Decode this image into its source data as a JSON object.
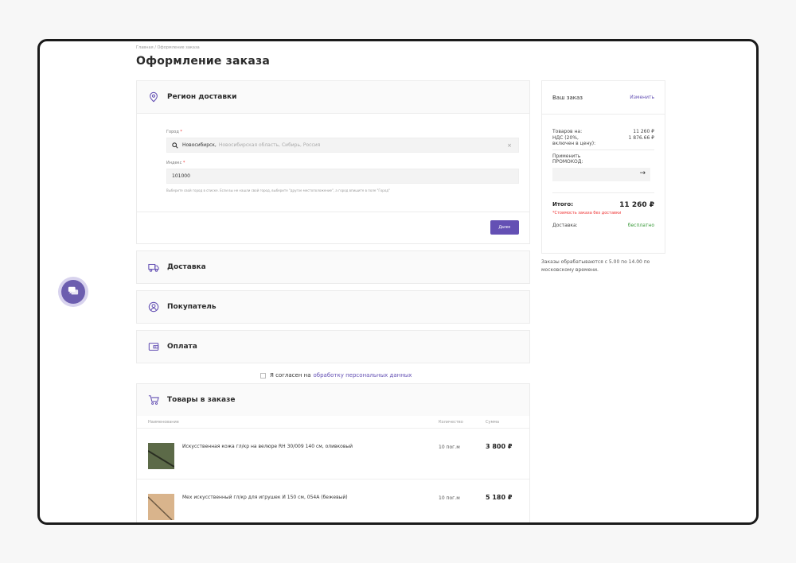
{
  "breadcrumb": {
    "home": "Главная",
    "sep": "/",
    "current": "Оформление заказа"
  },
  "page_title": "Оформление заказа",
  "sections": {
    "region": {
      "title": "Регион доставки"
    },
    "delivery": {
      "title": "Доставка"
    },
    "buyer": {
      "title": "Покупатель"
    },
    "payment": {
      "title": "Оплата"
    },
    "goods": {
      "title": "Товары в заказе"
    }
  },
  "region_form": {
    "city_label": "Город",
    "city_value": "Новосибирск",
    "city_detail": "Новосибирская область, Сибирь, Россия",
    "clear_icon": "×",
    "index_label": "Индекс",
    "index_value": "101000",
    "required_mark": "*",
    "hint": "Выберите свой город в списке. Если вы не нашли свой город, выберите \"другое местоположение\", а город впишите в поле \"Город\"",
    "next_button": "Далее"
  },
  "agreement": {
    "text": "Я согласен на",
    "link": "обработку персональных данных"
  },
  "goods_table": {
    "headers": {
      "name": "Наименование",
      "qty": "Количество",
      "sum": "Сумма"
    },
    "rows": [
      {
        "name": "Искусственная кожа гл/кр на велюре RH 30/009 140 см, оливковый",
        "qty": "10 пог.м",
        "sum": "3 800 ₽",
        "thumb_color": "#5c6a48"
      },
      {
        "name": "Мех искусственный гл/кр для игрушек И 150 см, 054А (бежевый)",
        "qty": "10 пог.м",
        "sum": "5 180 ₽",
        "thumb_color": "#d9b48c"
      }
    ]
  },
  "summary": {
    "title": "Ваш заказ",
    "edit": "Изменить",
    "goods_label": "Товаров на:",
    "goods_value": "11 260 ₽",
    "vat_label_1": "НДС (20%,",
    "vat_label_2": "включен в цену):",
    "vat_value": "1 876.66 ₽",
    "promo_label_1": "Применить",
    "promo_label_2": "ПРОМОКОД:",
    "promo_arrow": "→",
    "total_label": "Итого:",
    "total_value": "11 260 ₽",
    "total_note": "*Стоимость заказа без доставки",
    "delivery_label": "Доставка:",
    "delivery_value": "бесплатно"
  },
  "processing_note": "Заказы обрабатываются с 5.00 по 14.00 по московскому времени.",
  "colors": {
    "accent": "#6450b4",
    "chat": "#6c5eaf",
    "free": "#3a9a3a",
    "required": "#e33"
  },
  "icons": {
    "chat": "chat-icon",
    "region": "map-pin-icon",
    "delivery": "truck-icon",
    "buyer": "user-icon",
    "payment": "wallet-icon",
    "goods": "cart-icon",
    "search": "search-icon"
  }
}
